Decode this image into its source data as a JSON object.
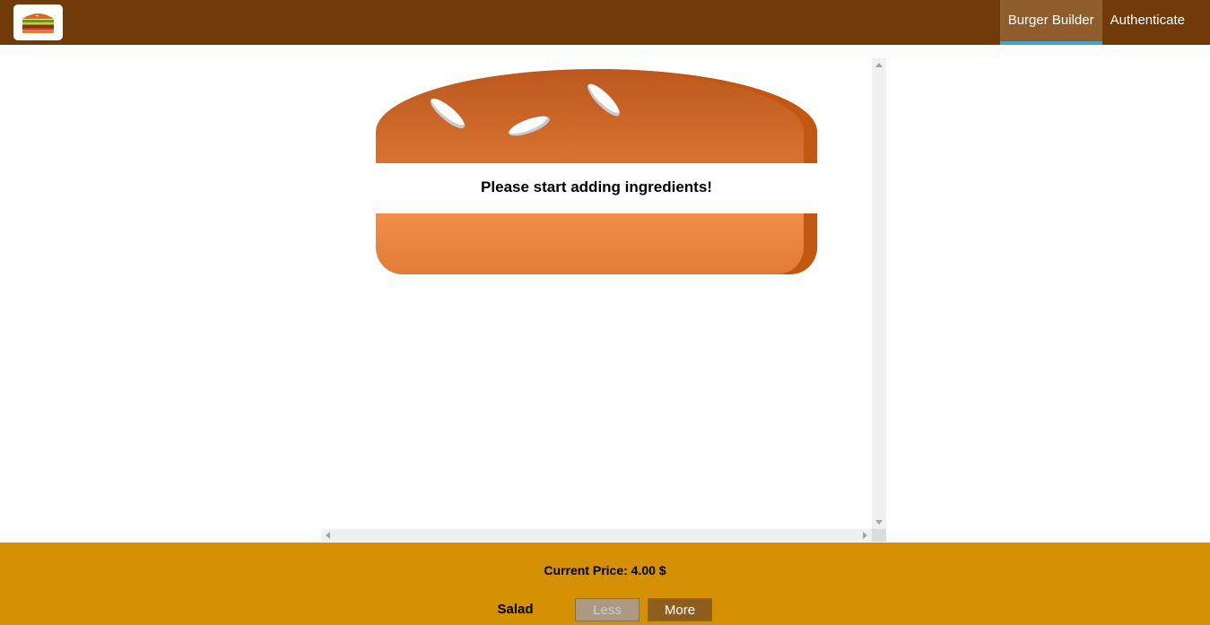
{
  "toolbar": {
    "logo_icon": "burger-logo-icon",
    "nav": [
      {
        "label": "Burger Builder",
        "active": true
      },
      {
        "label": "Authenticate",
        "active": false
      }
    ]
  },
  "burger": {
    "message": "Please start adding ingredients!"
  },
  "build_controls": {
    "price_text": "Current Price: 4.00 $",
    "controls": [
      {
        "label": "Salad",
        "less_label": "Less",
        "more_label": "More",
        "less_disabled": true
      }
    ]
  },
  "colors": {
    "toolbar": "#703B09",
    "controls_bg": "#D59000",
    "bread": "#e27b36",
    "active_underline": "#40A4C8",
    "more_button": "#8F5E1E",
    "less_button_disabled": "#AC9980"
  }
}
